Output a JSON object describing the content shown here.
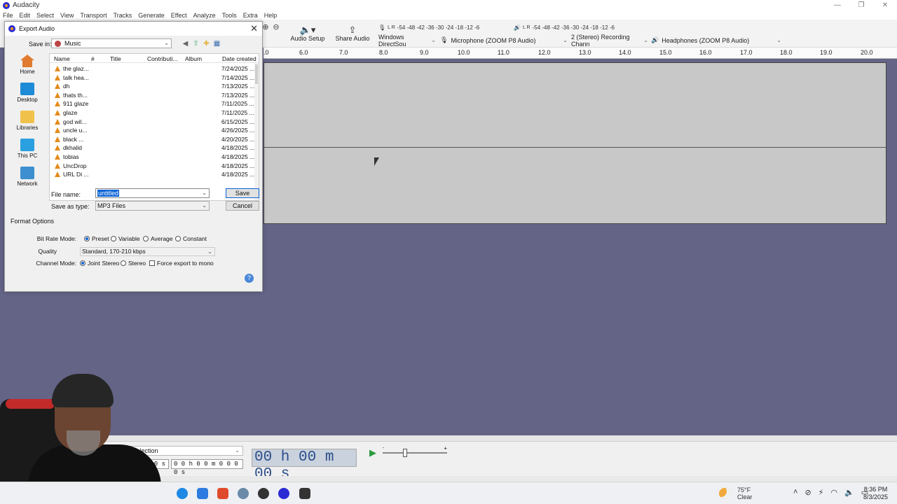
{
  "app": {
    "title": "Audacity",
    "window_controls": [
      "—",
      "❐",
      "✕"
    ]
  },
  "menu": [
    "File",
    "Edit",
    "Select",
    "View",
    "Transport",
    "Tracks",
    "Generate",
    "Effect",
    "Analyze",
    "Tools",
    "Extra",
    "Help"
  ],
  "toolbar": {
    "audio_setup": "Audio Setup",
    "share_audio": "Share Audio",
    "meter_scale": "-54 -48 -42 -36 -30 -24 -18 -12 -6",
    "meter_lr": "L R",
    "host": "Windows DirectSou",
    "mic": "Microphone (ZOOM P8 Audio)",
    "channels": "2 (Stereo) Recording Chann",
    "output": "Headphones (ZOOM P8 Audio)"
  },
  "ruler": {
    "ticks": [
      "6.0",
      "7.0",
      "8.0",
      "9.0",
      "10.0",
      "11.0",
      "12.0",
      "13.0",
      "14.0",
      "15.0",
      "16.0",
      "17.0",
      "18.0",
      "19.0",
      "20.0"
    ],
    "first_partial": ".0"
  },
  "bottom": {
    "selection_label": "d of Selection",
    "tc_small_1": "0 0 s",
    "tc_small_2": "0 0 h 0 0 m 0 0 0 0 s",
    "big_time": "00 h 00 m 00 s",
    "slider_minus": "-",
    "slider_plus": "+"
  },
  "taskbar": {
    "temp": "75°F",
    "condition": "Clear",
    "time": "8:36 PM",
    "date": "8/3/2025"
  },
  "dialog": {
    "title": "Export Audio",
    "save_in_label": "Save in:",
    "save_in_value": "Music",
    "places": [
      "Home",
      "Desktop",
      "Libraries",
      "This PC",
      "Network"
    ],
    "columns": [
      "Name",
      "#",
      "Title",
      "Contributi...",
      "Album",
      "Date created"
    ],
    "files": [
      {
        "name": "the glaz...",
        "date": "7/24/2025 ..."
      },
      {
        "name": "talk hea...",
        "date": "7/14/2025 ..."
      },
      {
        "name": "dh",
        "date": "7/13/2025 ..."
      },
      {
        "name": "thats th...",
        "date": "7/13/2025 ..."
      },
      {
        "name": "911 glaze",
        "date": "7/11/2025 ..."
      },
      {
        "name": "glaze",
        "date": "7/11/2025 ..."
      },
      {
        "name": "god wil...",
        "date": "6/15/2025 ..."
      },
      {
        "name": "uncle u...",
        "date": "4/26/2025 ..."
      },
      {
        "name": "black ...",
        "date": "4/20/2025 ..."
      },
      {
        "name": "dkhalid",
        "date": "4/18/2025 ..."
      },
      {
        "name": "tobias",
        "date": "4/18/2025 ..."
      },
      {
        "name": "UncDrop",
        "date": "4/18/2025 ..."
      },
      {
        "name": "URL Di ...",
        "date": "4/18/2025 ..."
      }
    ],
    "file_name_label": "File name:",
    "file_name_value": "untitled",
    "save_as_type_label": "Save as type:",
    "save_as_type_value": "MP3 Files",
    "save_button": "Save",
    "cancel_button": "Cancel",
    "format_options_title": "Format Options",
    "bit_rate_mode_label": "Bit Rate Mode:",
    "bit_rate_modes": [
      "Preset",
      "Variable",
      "Average",
      "Constant"
    ],
    "bit_rate_selected": "Preset",
    "quality_label": "Quality",
    "quality_value": "Standard, 170-210 kbps",
    "channel_mode_label": "Channel Mode:",
    "channel_modes": [
      "Joint Stereo",
      "Stereo"
    ],
    "channel_selected": "Joint Stereo",
    "force_mono_label": "Force export to mono",
    "help": "?"
  },
  "colors": {
    "background": "#646487",
    "track": "#c8c8c8",
    "accent": "#0a63d6",
    "file_icon": "#e68a1b"
  }
}
